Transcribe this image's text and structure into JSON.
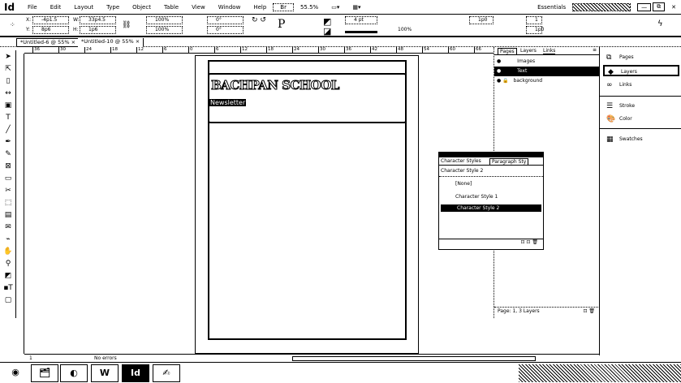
{
  "app": {
    "logo": "Id",
    "menu": [
      "File",
      "Edit",
      "Layout",
      "Type",
      "Object",
      "Table",
      "View",
      "Window",
      "Help"
    ],
    "zoom": "55.5%",
    "workspace": "Essentials"
  },
  "control": {
    "x": "-4p1.5",
    "y": "8p6",
    "w": "33p4.5",
    "h": "1p6",
    "scale_x": "100%",
    "scale_y": "100%",
    "angle": "0°",
    "shear": "0°",
    "stroke_weight": "4 pt",
    "opacity": "100%",
    "offset": "1p0",
    "columns": "1",
    "gutter": "1p0"
  },
  "tabs": [
    {
      "label": "*Untitled-6 @ 55%",
      "close": "×"
    },
    {
      "label": "*Untitled-10 @ 55%",
      "close": "×"
    }
  ],
  "ruler": [
    "36",
    "30",
    "24",
    "18",
    "12",
    "6",
    "0",
    "6",
    "12",
    "18",
    "24",
    "30",
    "36",
    "42",
    "48",
    "54",
    "60",
    "66"
  ],
  "document": {
    "heading": "BACHPAN SCHOOL",
    "subheading": "Newsletter"
  },
  "layers_panel": {
    "tabs": [
      "Pages",
      "Layers",
      "Links"
    ],
    "layers": [
      {
        "name": "Images"
      },
      {
        "name": "Text"
      },
      {
        "name": "background"
      }
    ],
    "footer": "Page: 1, 3 Layers"
  },
  "dock": {
    "items": [
      "Pages",
      "Layers",
      "Links",
      "Stroke",
      "Color",
      "Swatches"
    ]
  },
  "character_styles": {
    "tabs": [
      "Character Styles",
      "Paragraph Sty"
    ],
    "current": "Character Style 2",
    "items": [
      "[None]",
      "Character Style 1",
      "Character Style 2"
    ]
  },
  "status": {
    "page": "1",
    "errors": "No errors"
  }
}
